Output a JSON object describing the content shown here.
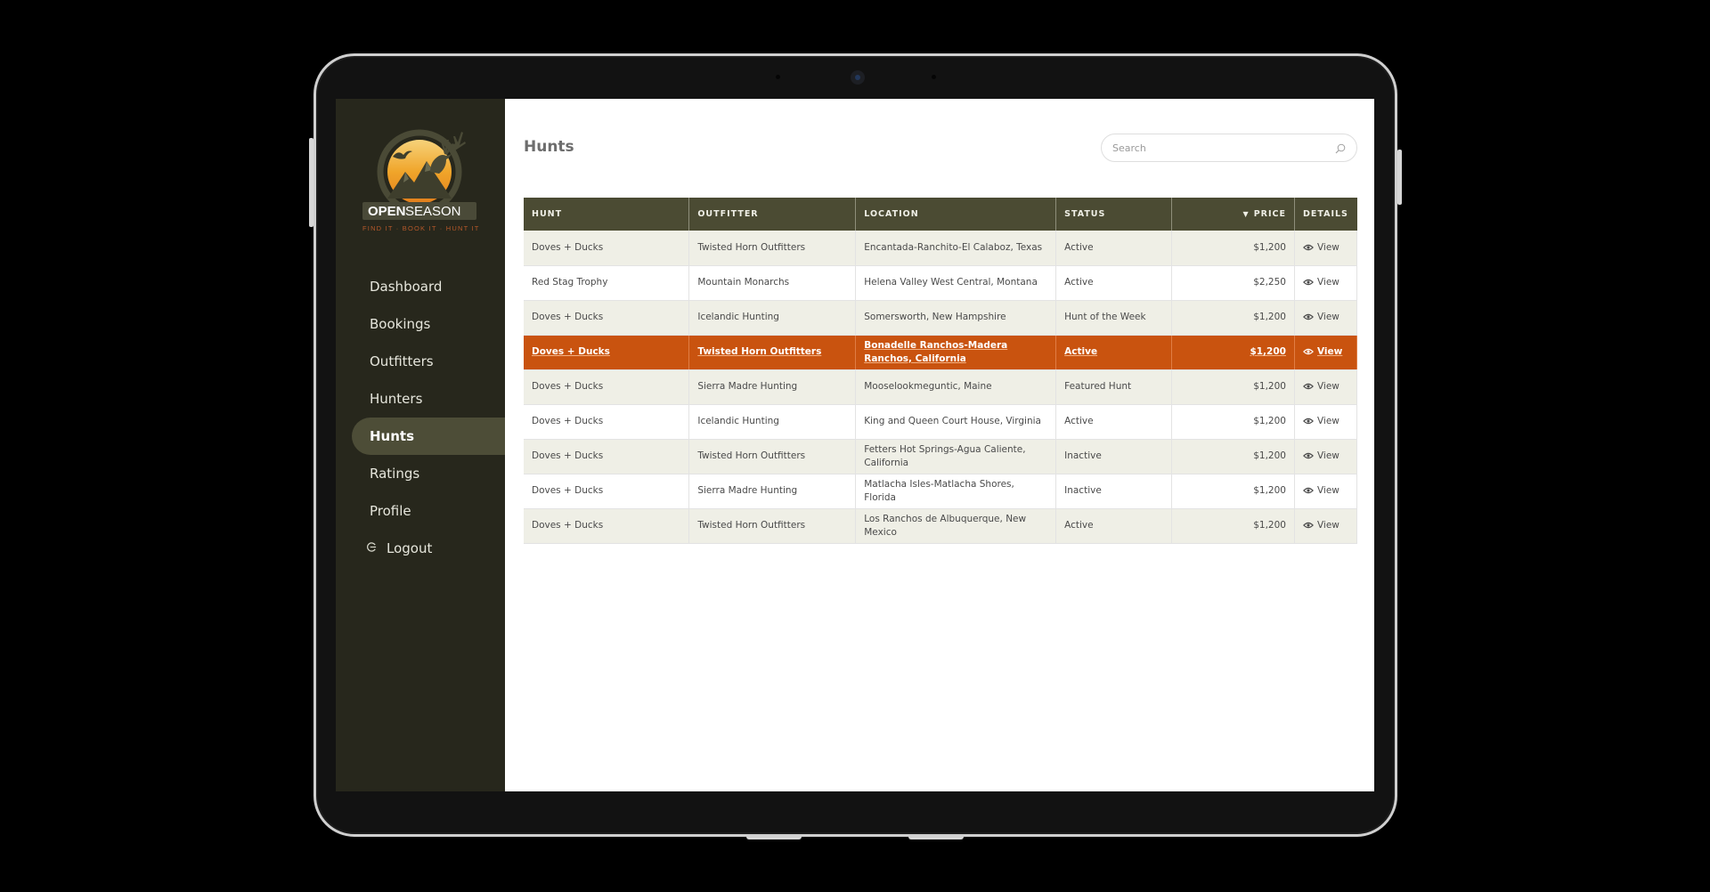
{
  "brand": {
    "name_bold": "OPEN",
    "name_light": "SEASON",
    "tagline": "FIND IT · BOOK IT · HUNT IT"
  },
  "sidebar": {
    "items": [
      {
        "label": "Dashboard",
        "active": false
      },
      {
        "label": "Bookings",
        "active": false
      },
      {
        "label": "Outfitters",
        "active": false
      },
      {
        "label": "Hunters",
        "active": false
      },
      {
        "label": "Hunts",
        "active": true
      },
      {
        "label": "Ratings",
        "active": false
      },
      {
        "label": "Profile",
        "active": false
      },
      {
        "label": "Logout",
        "active": false,
        "icon": "logout-icon"
      }
    ]
  },
  "header": {
    "title": "Hunts",
    "search_placeholder": "Search",
    "search_value": ""
  },
  "table": {
    "columns": [
      "Hunt",
      "Outfitter",
      "Location",
      "Status",
      "Price",
      "Details"
    ],
    "sort": {
      "column": "Price",
      "direction": "descending"
    },
    "rows": [
      {
        "hunt": "Doves + Ducks",
        "outfitter": "Twisted Horn Outfitters",
        "location": "Encantada-Ranchito-El Calaboz, Texas",
        "status": "Active",
        "price": "$1,200",
        "details": "View"
      },
      {
        "hunt": "Red Stag Trophy",
        "outfitter": "Mountain Monarchs",
        "location": "Helena Valley West Central, Montana",
        "status": "Active",
        "price": "$2,250",
        "details": "View"
      },
      {
        "hunt": "Doves + Ducks",
        "outfitter": "Icelandic Hunting",
        "location": "Somersworth, New Hampshire",
        "status": "Hunt of the Week",
        "price": "$1,200",
        "details": "View"
      },
      {
        "hunt": "Doves + Ducks",
        "outfitter": "Twisted Horn Outfitters",
        "location": "Bonadelle Ranchos-Madera Ranchos, California",
        "status": "Active",
        "price": "$1,200",
        "details": "View",
        "selected": true
      },
      {
        "hunt": "Doves + Ducks",
        "outfitter": "Sierra Madre Hunting",
        "location": "Mooselookmeguntic, Maine",
        "status": "Featured Hunt",
        "price": "$1,200",
        "details": "View"
      },
      {
        "hunt": "Doves + Ducks",
        "outfitter": "Icelandic Hunting",
        "location": "King and Queen Court House, Virginia",
        "status": "Active",
        "price": "$1,200",
        "details": "View"
      },
      {
        "hunt": "Doves + Ducks",
        "outfitter": "Twisted Horn Outfitters",
        "location": "Fetters Hot Springs-Agua Caliente, California",
        "status": "Inactive",
        "price": "$1,200",
        "details": "View"
      },
      {
        "hunt": "Doves + Ducks",
        "outfitter": "Sierra Madre Hunting",
        "location": "Matlacha Isles-Matlacha Shores, Florida",
        "status": "Inactive",
        "price": "$1,200",
        "details": "View"
      },
      {
        "hunt": "Doves + Ducks",
        "outfitter": "Twisted Horn Outfitters",
        "location": "Los Ranchos de Albuquerque, New Mexico",
        "status": "Active",
        "price": "$1,200",
        "details": "View"
      }
    ]
  },
  "colors": {
    "sidebar_bg": "#27271c",
    "sidebar_active": "#4d4d37",
    "table_header": "#4b4b33",
    "row_alt": "#efefe6",
    "row_selected": "#c9530f",
    "logo_sun": "#f0a52a"
  }
}
